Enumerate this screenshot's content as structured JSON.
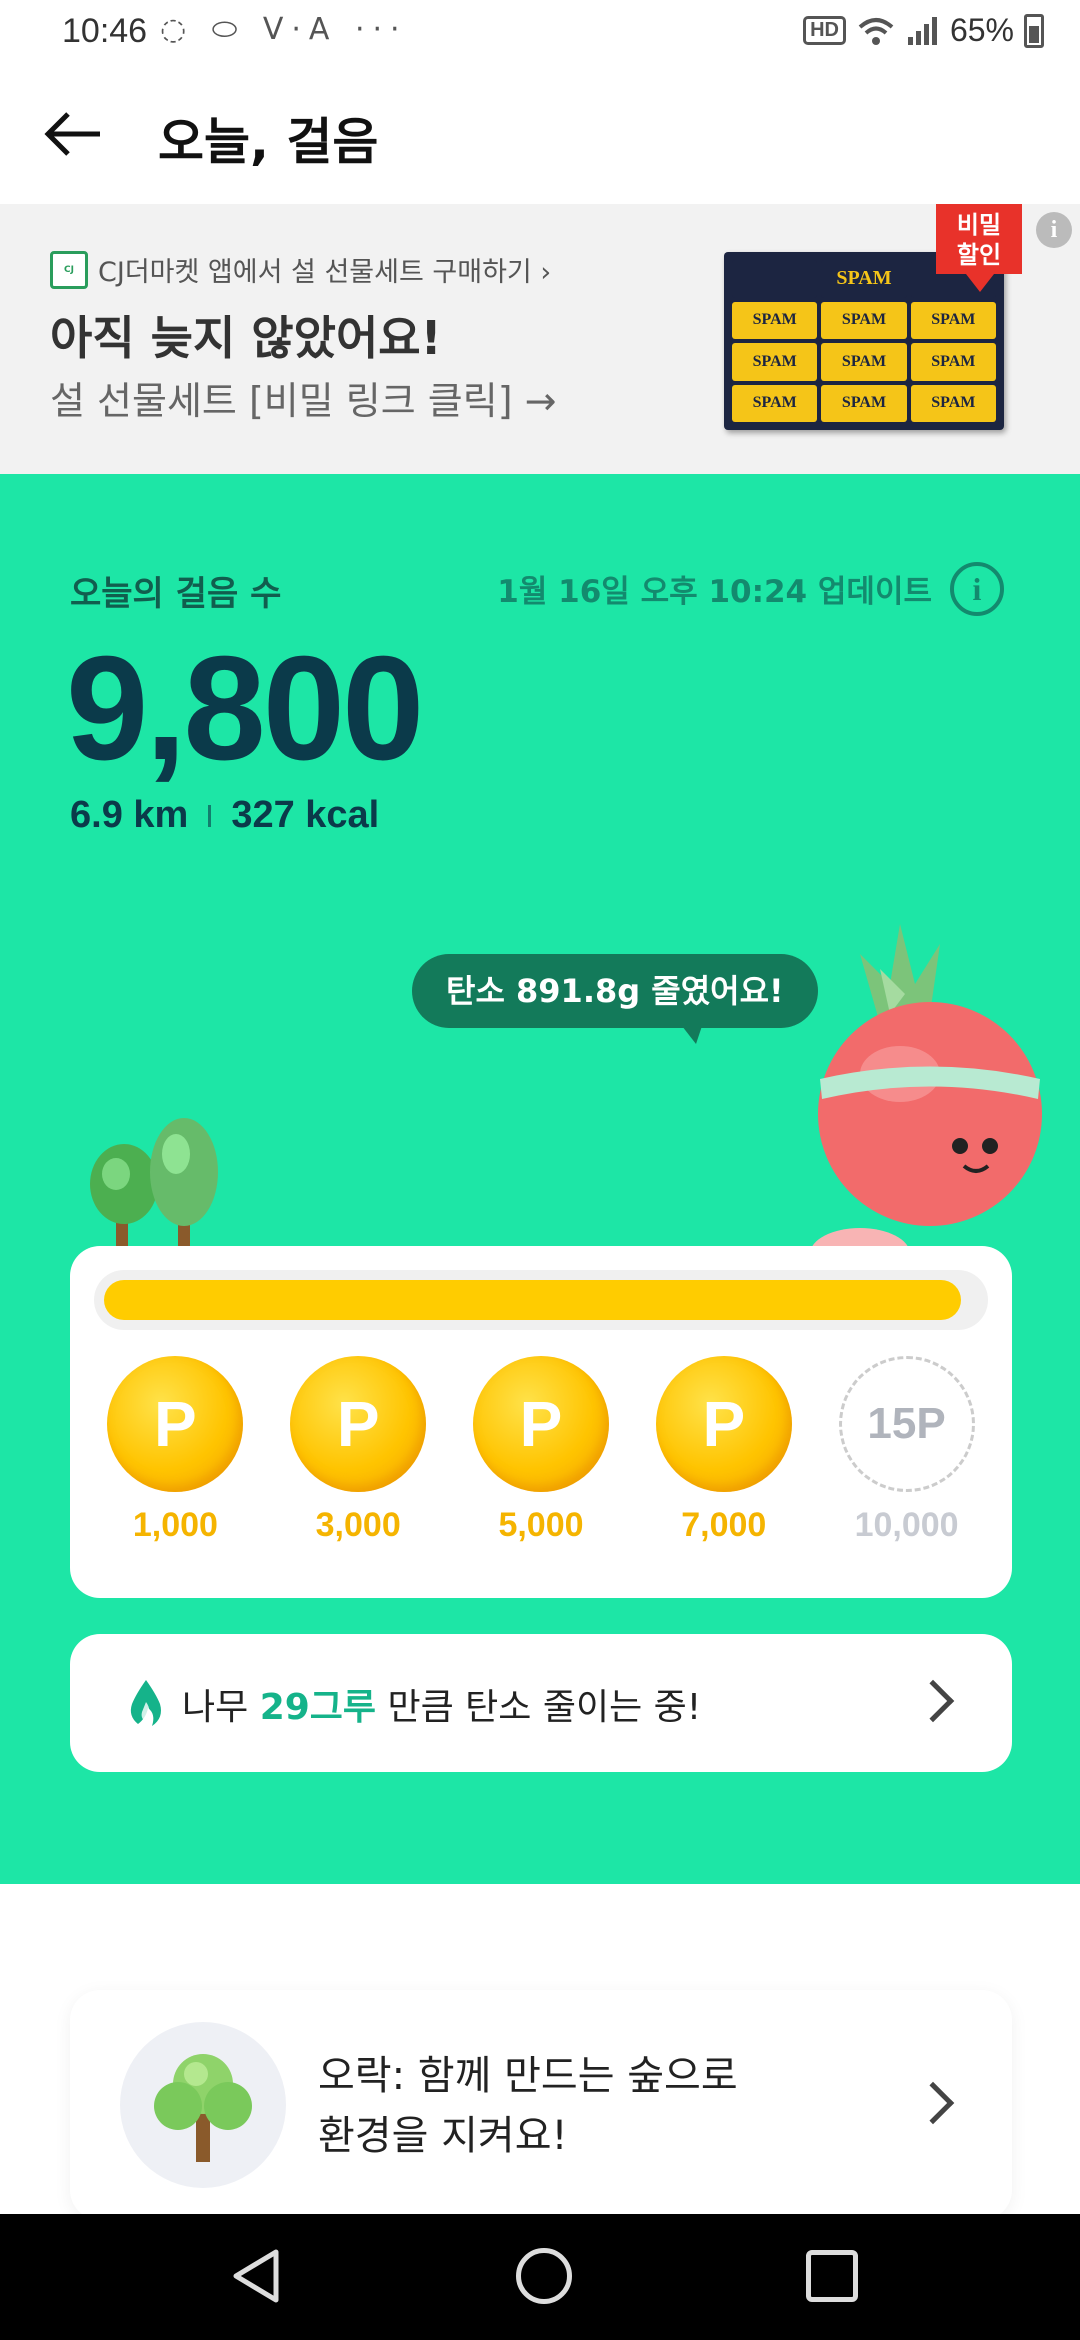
{
  "status_bar": {
    "time": "10:46",
    "left_icons": "◌ ⬭ V·A ···",
    "hd": "HD",
    "battery": "65%"
  },
  "header": {
    "title": "오늘, 걸음"
  },
  "banner": {
    "source": "CJ더마켓 앱에서 설 선물세트 구매하기 ›",
    "title": "아직 늦지 않았어요!",
    "subtitle": "설 선물세트 [비밀 링크 클릭] →",
    "product_brand": "SPAM",
    "badge_line1": "비밀",
    "badge_line2": "할인",
    "info": "i"
  },
  "steps": {
    "label": "오늘의 걸음 수",
    "updated": "1월 16일 오후 10:24 업데이트",
    "info": "i",
    "count": "9,800",
    "distance": "6.9 km",
    "calories": "327 kcal"
  },
  "carbon_bubble": "탄소 891.8g 줄였어요!",
  "rewards": {
    "progress_fraction": 0.98,
    "milestones": [
      {
        "symbol": "P",
        "amount": "1,000",
        "reached": true
      },
      {
        "symbol": "P",
        "amount": "3,000",
        "reached": true
      },
      {
        "symbol": "P",
        "amount": "5,000",
        "reached": true
      },
      {
        "symbol": "P",
        "amount": "7,000",
        "reached": true
      },
      {
        "symbol": "15P",
        "amount": "10,000",
        "reached": false
      }
    ]
  },
  "carbon_card": {
    "prefix": "나무 ",
    "trees": "29그루",
    "suffix": " 만큼 탄소 줄이는 중!"
  },
  "forest_card": {
    "line1": "오락: 함께 만드는 숲으로",
    "line2": "환경을 지켜요!"
  },
  "colors": {
    "accent_green": "#1de6a6",
    "coin_gold": "#ffc400",
    "dark_text": "#0b3a4a"
  }
}
